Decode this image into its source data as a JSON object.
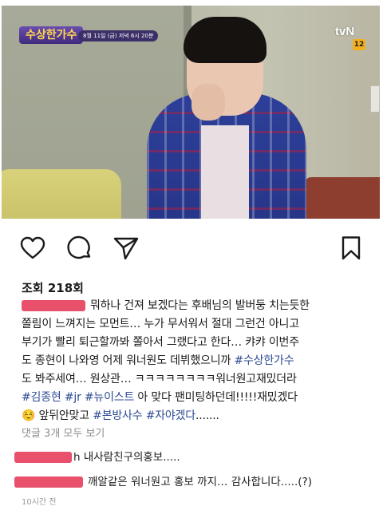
{
  "video": {
    "show_logo": "수상한가수",
    "show_schedule": "8월 11일 (금) 저녁 6시 20분",
    "channel": "tvN",
    "rating": "12"
  },
  "actions": {
    "like_icon": "heart-icon",
    "comment_icon": "comment-icon",
    "share_icon": "send-icon",
    "save_icon": "bookmark-icon"
  },
  "views": "조회 218회",
  "caption": {
    "line1_text": "뭐하나 건져 보겠다는 후배님의 발버둥 치는듯한",
    "line2": "쫄림이 느껴지는 모먼트… 누가 무서워서 절대 그런건 아니고",
    "line3": "부기가 빨리 퇴근할까봐 쫄아서 그랬다고 한다… 캬캬 이번주",
    "line4_text": "도 종현이 나와영 어제 워너원도 데뷔했으니까",
    "line4_tag": "#수상한가수",
    "line5": "도 봐주세여… 원상관… ㅋㅋㅋㅋㅋㅋㅋㅋ워너원고재밌더라",
    "line6_tags": [
      "#김종현",
      "#jr",
      "#뉴이스트"
    ],
    "line6_text": "아 맞다 팬미팅하던데!!!!!재밌겠다",
    "line7_emoji": "☺️",
    "line7_text": "앞뒤안맞고",
    "line7_tags": [
      "#본방사수",
      "#자야겠다"
    ],
    "line7_end": "......."
  },
  "view_comments": "댓글 3개 모두 보기",
  "comments": [
    {
      "text": "h 내사람친구의홍보....."
    },
    {
      "text": "깨알같은 워너원고 홍보 까지… 감사합니다.....(?)"
    }
  ],
  "timestamp": "10시간 전",
  "colors": {
    "hashtag": "#2c4a93",
    "redaction": "#e8506b",
    "muted": "#8e8e8e"
  }
}
